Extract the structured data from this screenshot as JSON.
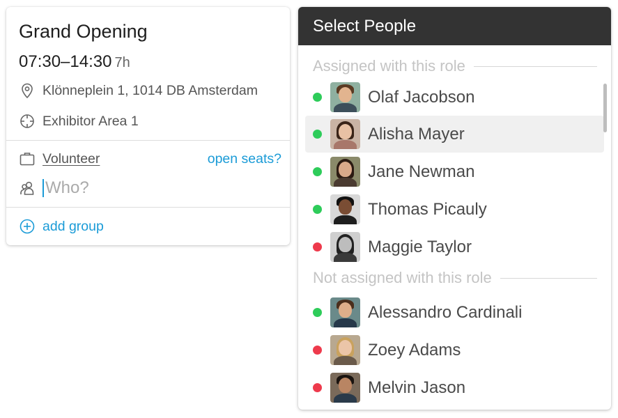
{
  "shift": {
    "title": "Grand Opening",
    "time": "07:30–14:30",
    "duration": "7h",
    "location": "Klönneplein 1, 1014 DB Amsterdam",
    "area": "Exhibitor Area 1",
    "role": "Volunteer",
    "open_seats": "open seats?",
    "who_placeholder": "Who?",
    "add_group": "add group"
  },
  "panel": {
    "title": "Select People",
    "assigned_label": "Assigned with this role",
    "not_assigned_label": "Not assigned with this role",
    "assigned": [
      {
        "name": "Olaf Jacobson",
        "status": "available"
      },
      {
        "name": "Alisha Mayer",
        "status": "available"
      },
      {
        "name": "Jane Newman",
        "status": "available"
      },
      {
        "name": "Thomas Picauly",
        "status": "available"
      },
      {
        "name": "Maggie Taylor",
        "status": "unavailable"
      }
    ],
    "not_assigned": [
      {
        "name": "Alessandro Cardinali",
        "status": "available"
      },
      {
        "name": "Zoey Adams",
        "status": "unavailable"
      },
      {
        "name": "Melvin Jason",
        "status": "unavailable"
      }
    ]
  },
  "colors": {
    "accent": "#1a9bd7",
    "available": "#2ecc5a",
    "unavailable": "#ee3a4c",
    "header": "#333333"
  },
  "icons": {
    "location": "map-pin-icon",
    "area": "crosshair-icon",
    "role": "briefcase-icon",
    "who": "people-icon",
    "add_group": "plus-circle-icon"
  }
}
